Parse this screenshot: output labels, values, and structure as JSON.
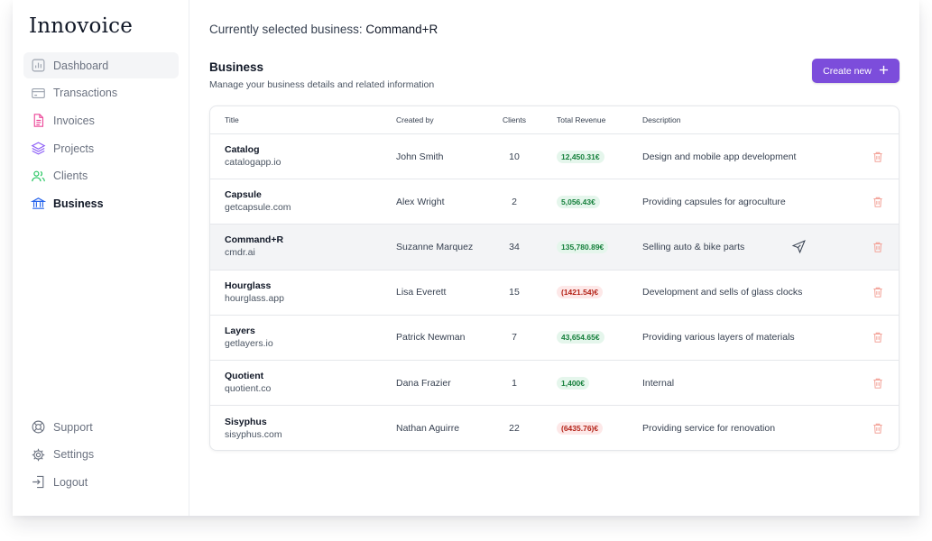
{
  "app": {
    "logo": "Innovoice"
  },
  "colors": {
    "accent": "#7c4ddb",
    "positive": "#16803c",
    "negative": "#b42318",
    "delete": "#f3a49a"
  },
  "sidebar": {
    "items": [
      {
        "label": "Dashboard",
        "icon": "bar-chart-icon"
      },
      {
        "label": "Transactions",
        "icon": "card-icon"
      },
      {
        "label": "Invoices",
        "icon": "document-icon"
      },
      {
        "label": "Projects",
        "icon": "layers-icon"
      },
      {
        "label": "Clients",
        "icon": "users-icon"
      },
      {
        "label": "Business",
        "icon": "bank-icon"
      }
    ],
    "bottom": [
      {
        "label": "Support",
        "icon": "lifebuoy-icon"
      },
      {
        "label": "Settings",
        "icon": "gear-icon"
      },
      {
        "label": "Logout",
        "icon": "logout-icon"
      }
    ]
  },
  "header": {
    "selected_label": "Currently selected business:",
    "selected_value": "Command+R"
  },
  "section": {
    "title": "Business",
    "subtitle": "Manage your business details and related information",
    "create_label": "Create new",
    "create_icon": "plus-icon"
  },
  "table": {
    "columns": [
      "Title",
      "Created by",
      "Clients",
      "Total Revenue",
      "Description"
    ],
    "rows": [
      {
        "name": "Catalog",
        "domain": "catalogapp.io",
        "created_by": "John Smith",
        "clients": "10",
        "revenue": "12,450.31€",
        "revenue_sign": "pos",
        "description": "Design and mobile app development"
      },
      {
        "name": "Capsule",
        "domain": "getcapsule.com",
        "created_by": "Alex Wright",
        "clients": "2",
        "revenue": "5,056.43€",
        "revenue_sign": "pos",
        "description": "Providing capsules for agroculture"
      },
      {
        "name": "Command+R",
        "domain": "cmdr.ai",
        "created_by": "Suzanne Marquez",
        "clients": "34",
        "revenue": "135,780.89€",
        "revenue_sign": "pos",
        "description": "Selling auto & bike parts"
      },
      {
        "name": "Hourglass",
        "domain": "hourglass.app",
        "created_by": "Lisa Everett",
        "clients": "15",
        "revenue": "(1421.54)€",
        "revenue_sign": "neg",
        "description": "Development and sells of glass clocks"
      },
      {
        "name": "Layers",
        "domain": "getlayers.io",
        "created_by": "Patrick Newman",
        "clients": "7",
        "revenue": "43,654.65€",
        "revenue_sign": "pos",
        "description": "Providing various layers of materials"
      },
      {
        "name": "Quotient",
        "domain": "quotient.co",
        "created_by": "Dana Frazier",
        "clients": "1",
        "revenue": "1,400€",
        "revenue_sign": "pos",
        "description": "Internal"
      },
      {
        "name": "Sisyphus",
        "domain": "sisyphus.com",
        "created_by": "Nathan Aguirre",
        "clients": "22",
        "revenue": "(6435.76)€",
        "revenue_sign": "neg",
        "description": "Providing service for renovation"
      }
    ]
  }
}
